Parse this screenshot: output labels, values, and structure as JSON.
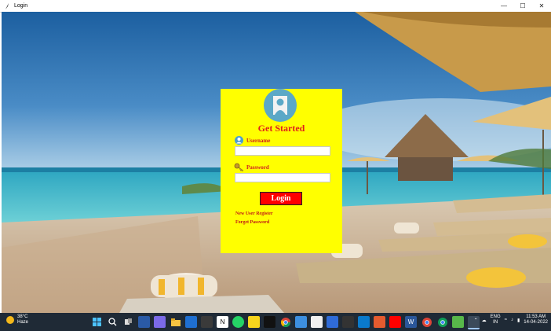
{
  "window": {
    "title": "Login",
    "controls": [
      "minimize",
      "maximize",
      "close"
    ]
  },
  "login": {
    "heading": "Get Started",
    "username_label": "Username",
    "password_label": "Password",
    "username_value": "",
    "password_value": "",
    "login_button": "Login",
    "new_user_link": "New User Register",
    "forget_password_link": "Forget Password"
  },
  "taskbar": {
    "weather_temp": "38°C",
    "weather_desc": "Haze",
    "language": "ENG",
    "region": "IN",
    "time": "11:53 AM",
    "date": "14-04-2022",
    "apps": [
      "start-icon",
      "search-icon",
      "task-view-icon",
      "widgets-icon",
      "chat-icon",
      "file-explorer-icon",
      "mail-icon",
      "store-icon",
      "notion-icon",
      "whatsapp-icon",
      "notes-icon",
      "terminal-icon",
      "chrome-icon",
      "phone-icon",
      "paint-icon",
      "photos-icon",
      "vscode-icon",
      "app-icon",
      "youtube-icon",
      "word-icon",
      "chrome-icon-2",
      "chrome-icon-3",
      "app-icon-2",
      "python-icon"
    ]
  },
  "colors": {
    "card_bg": "#ffff00",
    "heading": "#e0201b",
    "button_bg": "#ff0000",
    "taskbar": "#1f2a36"
  }
}
